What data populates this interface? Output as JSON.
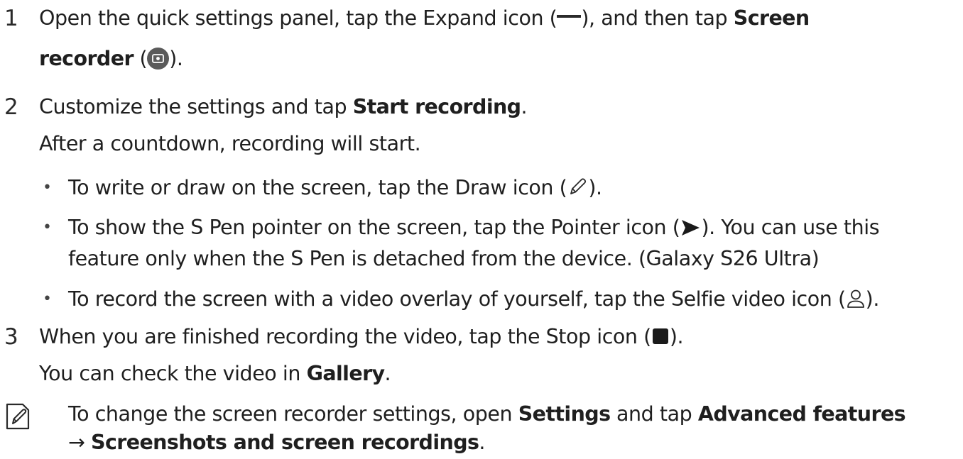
{
  "steps": [
    {
      "number": "1",
      "line1_text": "Open the quick settings panel, tap the Expand icon (",
      "line1_after_icon": "), and then tap ",
      "line1_bold": "Screen",
      "line2_bold": "recorder",
      "line2_open": " (",
      "line2_close": ")."
    },
    {
      "number": "2",
      "line1_text": "Customize the settings and tap ",
      "line1_bold": "Start recording",
      "line1_end": ".",
      "line2_text": "After a countdown, recording will start."
    },
    {
      "number": "3",
      "line1_text": "When you are finished recording the video, tap the Stop icon (",
      "line1_end": ").",
      "line2_text": "You can check the video in ",
      "line2_bold": "Gallery",
      "line2_end": "."
    }
  ],
  "bullets": [
    {
      "before": "To write or draw on the screen, tap the Draw icon (",
      "after": ")."
    },
    {
      "before": "To show the S Pen pointer on the screen, tap the Pointer icon (",
      "after": "). You can use this",
      "line2": "feature only when the S Pen is detached from the device. (Galaxy S26 Ultra)"
    },
    {
      "before": "To record the screen with a video overlay of yourself, tap the Selfie video icon (",
      "after": ")."
    }
  ],
  "bullet_char": "•",
  "note": {
    "line1_before": "To change the screen recorder settings, open ",
    "line1_bold1": "Settings",
    "line1_mid": " and tap ",
    "line1_bold2": "Advanced features",
    "arrow": "→ ",
    "line2_bold": "Screenshots and screen recordings",
    "line2_end": "."
  }
}
